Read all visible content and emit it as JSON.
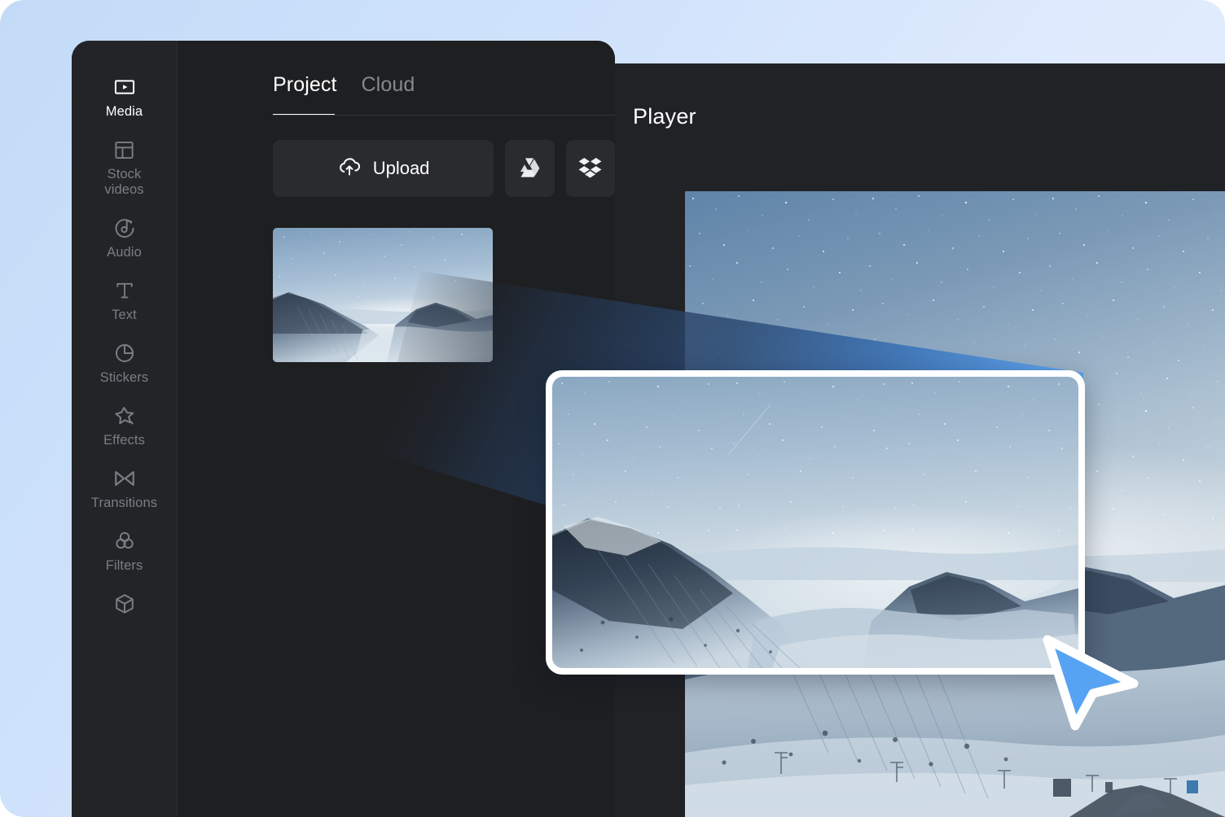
{
  "app": {
    "background_color": "#c3dbf8",
    "panel_color": "#1e1f21",
    "accent_color": "#4f9bf0"
  },
  "sidebar": {
    "items": [
      {
        "id": "media",
        "label": "Media",
        "icon": "media-play-icon",
        "active": true
      },
      {
        "id": "stock",
        "label": "Stock\nvideos",
        "icon": "layout-grid-icon",
        "active": false
      },
      {
        "id": "audio",
        "label": "Audio",
        "icon": "audio-note-icon",
        "active": false
      },
      {
        "id": "text",
        "label": "Text",
        "icon": "text-t-icon",
        "active": false
      },
      {
        "id": "stickers",
        "label": "Stickers",
        "icon": "sticker-circle-icon",
        "active": false
      },
      {
        "id": "effects",
        "label": "Effects",
        "icon": "effects-star-icon",
        "active": false
      },
      {
        "id": "transitions",
        "label": "Transitions",
        "icon": "transitions-bowtie-icon",
        "active": false
      },
      {
        "id": "filters",
        "label": "Filters",
        "icon": "filters-circles-icon",
        "active": false
      },
      {
        "id": "more",
        "label": "",
        "icon": "cube-icon",
        "active": false
      }
    ]
  },
  "media_panel": {
    "tabs": [
      {
        "id": "project",
        "label": "Project",
        "active": true
      },
      {
        "id": "cloud",
        "label": "Cloud",
        "active": false
      }
    ],
    "upload": {
      "label": "Upload",
      "icon": "cloud-upload-icon"
    },
    "cloud_services": [
      {
        "id": "google-drive",
        "icon": "google-drive-icon"
      },
      {
        "id": "dropbox",
        "icon": "dropbox-icon"
      }
    ],
    "thumbnails": [
      {
        "id": "clip-1",
        "alt": "snowy mountain night sky clip"
      }
    ]
  },
  "player": {
    "title": "Player"
  },
  "drag": {
    "card_alt": "snowy mountain night sky clip being dragged",
    "cursor_icon": "arrow-cursor-icon",
    "cursor_color": "#4f9bf0"
  }
}
